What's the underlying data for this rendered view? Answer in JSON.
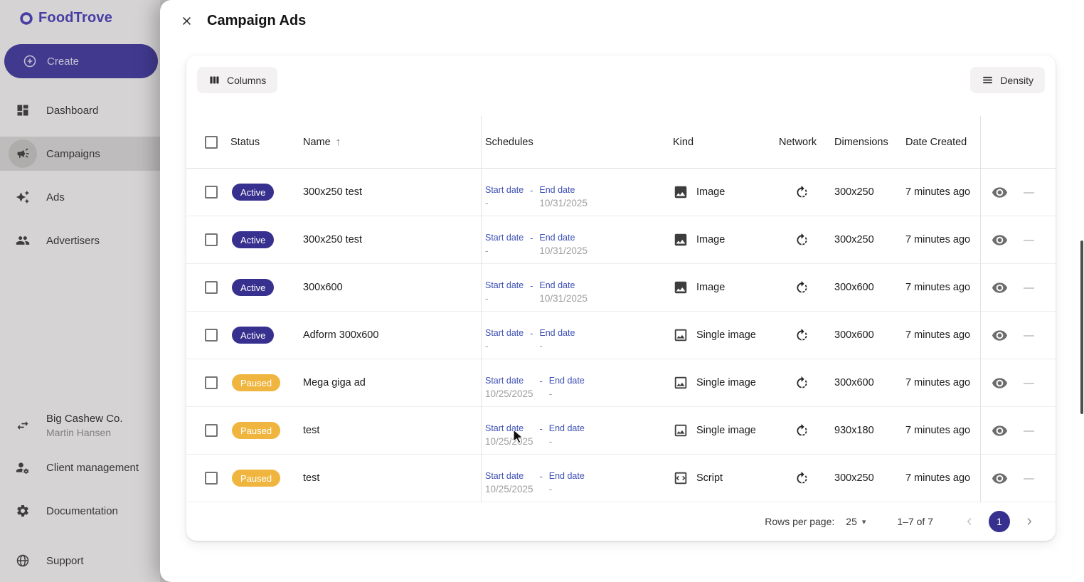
{
  "colors": {
    "accent": "#38308e",
    "schedule_label": "#3f51b5",
    "paused": "#efb53f",
    "create_button": "#453c9f",
    "brand": "#4b42b8"
  },
  "glyphs": {
    "sort_asc": "↑",
    "caret_down": "▾",
    "action_dash": "—",
    "schedule_dash": "-"
  },
  "brand": {
    "name": "FoodTrove"
  },
  "sidebar": {
    "create_label": "Create",
    "items": [
      {
        "label": "Dashboard"
      },
      {
        "label": "Campaigns"
      },
      {
        "label": "Ads"
      },
      {
        "label": "Advertisers"
      }
    ],
    "account": {
      "company": "Big Cashew Co.",
      "user": "Martin Hansen"
    },
    "footer_items": [
      {
        "label": "Client management"
      },
      {
        "label": "Documentation"
      },
      {
        "label": "Support"
      }
    ]
  },
  "modal": {
    "title": "Campaign Ads",
    "toolbar": {
      "columns_label": "Columns",
      "density_label": "Density"
    },
    "table": {
      "headers": {
        "status": "Status",
        "name": "Name",
        "schedules": "Schedules",
        "kind": "Kind",
        "network": "Network",
        "dimensions": "Dimensions",
        "date_created": "Date Created"
      },
      "schedule_labels": {
        "start": "Start date",
        "end": "End date"
      },
      "rows": [
        {
          "status": "Active",
          "name": "300x250 test",
          "start_date": "-",
          "end_date": "10/31/2025",
          "kind": "Image",
          "kind_icon": "image-filled",
          "dimensions": "300x250",
          "date_created": "7 minutes ago"
        },
        {
          "status": "Active",
          "name": "300x250 test",
          "start_date": "-",
          "end_date": "10/31/2025",
          "kind": "Image",
          "kind_icon": "image-filled",
          "dimensions": "300x250",
          "date_created": "7 minutes ago"
        },
        {
          "status": "Active",
          "name": "300x600",
          "start_date": "-",
          "end_date": "10/31/2025",
          "kind": "Image",
          "kind_icon": "image-filled",
          "dimensions": "300x600",
          "date_created": "7 minutes ago"
        },
        {
          "status": "Active",
          "name": "Adform 300x600",
          "start_date": "-",
          "end_date": "-",
          "kind": "Single image",
          "kind_icon": "image-outline",
          "dimensions": "300x600",
          "date_created": "7 minutes ago"
        },
        {
          "status": "Paused",
          "name": "Mega giga ad",
          "start_date": "10/25/2025",
          "end_date": "-",
          "kind": "Single image",
          "kind_icon": "image-outline",
          "dimensions": "300x600",
          "date_created": "7 minutes ago"
        },
        {
          "status": "Paused",
          "name": "test",
          "start_date": "10/25/2025",
          "end_date": "-",
          "kind": "Single image",
          "kind_icon": "image-outline",
          "dimensions": "930x180",
          "date_created": "7 minutes ago"
        },
        {
          "status": "Paused",
          "name": "test",
          "start_date": "10/25/2025",
          "end_date": "-",
          "kind": "Script",
          "kind_icon": "script",
          "dimensions": "300x250",
          "date_created": "7 minutes ago"
        }
      ]
    },
    "pagination": {
      "rows_per_page_label": "Rows per page:",
      "rows_per_page_value": "25",
      "range_label": "1–7 of 7",
      "current_page": "1"
    }
  }
}
